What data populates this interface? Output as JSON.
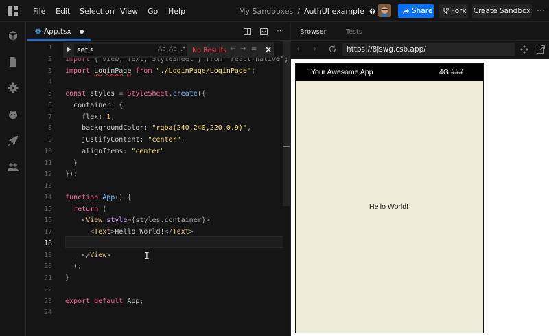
{
  "menu": {
    "file": "File",
    "edit": "Edit",
    "selection": "Selection",
    "view": "View",
    "go": "Go",
    "help": "Help"
  },
  "breadcrumb": {
    "parent": "My Sandboxes",
    "separator": "/",
    "project": "AuthUI example"
  },
  "toolbar": {
    "share_label": "Share",
    "fork_label": "Fork",
    "create_label": "Create Sandbox"
  },
  "editor": {
    "tab_label": "App.tsx",
    "line_numbers": [
      "1",
      "2",
      "3",
      "4",
      "5",
      "6",
      "7",
      "8",
      "9",
      "10",
      "11",
      "12",
      "13",
      "14",
      "15",
      "16",
      "17",
      "18",
      "19",
      "20",
      "21",
      "22",
      "23",
      "24"
    ],
    "active_line": "18"
  },
  "find": {
    "query": "setis",
    "status": "No Results",
    "opt_case": "Aa",
    "opt_word": "Ab",
    "opt_regex": ".*"
  },
  "code": {
    "l1_import": "import",
    "l1_rest": " { View, Text, StyleSheet } from \"react-native\";",
    "l3_import": "import",
    "l3_name": "LoginPage",
    "l3_from": "from",
    "l3_str": "\"./LoginPage/LoginPage\"",
    "l3_end": ";",
    "l5_const": "const",
    "l5_name": "styles",
    "l5_eq": "=",
    "l5_obj": "StyleSheet",
    "l5_method": "create",
    "l5_end": "({",
    "l6": "container: {",
    "l7_prop": "flex:",
    "l7_val": "1",
    "l7_end": ",",
    "l8_prop": "backgroundColor:",
    "l8_val": "\"rgba(240,240,220,0.9)\"",
    "l8_end": ",",
    "l9_prop": "justifyContent:",
    "l9_val": "\"center\"",
    "l9_end": ",",
    "l10_prop": "alignItems:",
    "l10_val": "\"center\"",
    "l11": "}",
    "l12": "});",
    "l14_kw": "function",
    "l14_name": "App",
    "l14_end": "() {",
    "l15_kw": "return",
    "l15_end": "(",
    "l16_open": "<",
    "l16_tag": "View",
    "l16_attr": "style",
    "l16_val": "={styles.container}",
    "l16_close": ">",
    "l17_open": "<",
    "l17_tag": "Text",
    "l17_close": ">",
    "l17_text": "Hello World!",
    "l17_end_open": "</",
    "l17_end_tag": "Text",
    "l17_end_close": ">",
    "l19_open": "</",
    "l19_tag": "View",
    "l19_close": ">",
    "l20": ");",
    "l21": "}",
    "l23_export": "export",
    "l23_default": "default",
    "l23_name": "App",
    "l23_end": ";"
  },
  "preview": {
    "tab_browser": "Browser",
    "tab_tests": "Tests",
    "url": "https://8jswg.csb.app/",
    "app_title": "Your Awesome App",
    "signal": "4G  ###",
    "body_text": "Hello World!"
  },
  "colors": {
    "accent": "#0971f1",
    "app_background": "#efecda",
    "error": "#e63946"
  },
  "icons": {
    "logo": "codesandbox-logo-icon",
    "explorer": "cube-icon",
    "files": "file-icon",
    "settings": "gear-icon",
    "github": "github-icon",
    "deploy": "rocket-icon",
    "team": "users-icon"
  }
}
